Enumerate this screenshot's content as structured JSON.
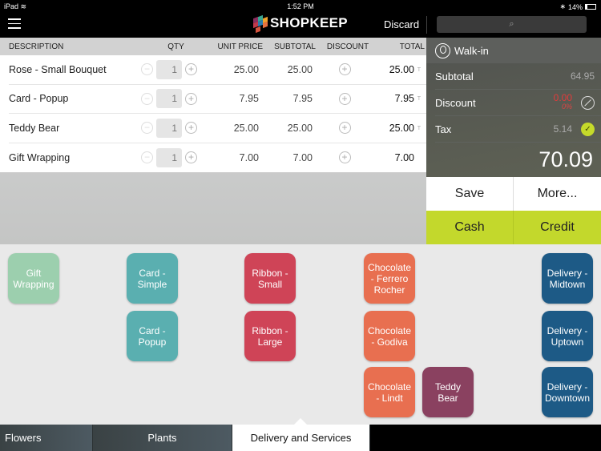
{
  "status_bar": {
    "device": "iPad",
    "time": "1:52 PM",
    "battery": "14%"
  },
  "header": {
    "brand": "SHOPKEEP",
    "discard_label": "Discard",
    "search_icon": "search-icon"
  },
  "cart": {
    "columns": {
      "description": "DESCRIPTION",
      "qty": "QTY",
      "unit_price": "UNIT PRICE",
      "subtotal": "SUBTOTAL",
      "discount": "DISCOUNT",
      "total": "TOTAL"
    },
    "rows": [
      {
        "description": "Rose - Small Bouquet",
        "qty": "1",
        "unit_price": "25.00",
        "subtotal": "25.00",
        "total": "25.00",
        "taxed": "T"
      },
      {
        "description": "Card - Popup",
        "qty": "1",
        "unit_price": "7.95",
        "subtotal": "7.95",
        "total": "7.95",
        "taxed": "T"
      },
      {
        "description": "Teddy Bear",
        "qty": "1",
        "unit_price": "25.00",
        "subtotal": "25.00",
        "total": "25.00",
        "taxed": "T"
      },
      {
        "description": "Gift Wrapping",
        "qty": "1",
        "unit_price": "7.00",
        "subtotal": "7.00",
        "total": "7.00",
        "taxed": ""
      }
    ]
  },
  "summary": {
    "customer": "Walk-in",
    "subtotal_label": "Subtotal",
    "subtotal": "64.95",
    "discount_label": "Discount",
    "discount": "0.00",
    "discount_pct": "0%",
    "tax_label": "Tax",
    "tax": "5.14",
    "grand_total": "70.09"
  },
  "actions": {
    "save": "Save",
    "more": "More...",
    "cash": "Cash",
    "credit": "Credit"
  },
  "tiles": [
    {
      "label": "Gift Wrapping",
      "color": "#9ccfae"
    },
    {
      "label": "Card - Simple",
      "color": "#5aafb0"
    },
    {
      "label": "Card - Popup",
      "color": "#5aafb0"
    },
    {
      "label": "Ribbon - Small",
      "color": "#cf4457"
    },
    {
      "label": "Ribbon - Large",
      "color": "#cf4457"
    },
    {
      "label": "Chocolate - Ferrero Rocher",
      "color": "#e86f50"
    },
    {
      "label": "Chocolate - Godiva",
      "color": "#e86f50"
    },
    {
      "label": "Chocolate - Lindt",
      "color": "#e86f50"
    },
    {
      "label": "Teddy Bear",
      "color": "#8a4160"
    },
    {
      "label": "Delivery - Midtown",
      "color": "#1d5a86"
    },
    {
      "label": "Delivery - Uptown",
      "color": "#1d5a86"
    },
    {
      "label": "Delivery - Downtown",
      "color": "#1d5a86"
    }
  ],
  "tabs": [
    {
      "label": "Flowers"
    },
    {
      "label": "Plants"
    },
    {
      "label": "Delivery and Services",
      "active": true
    }
  ],
  "colors": {
    "accent_green": "#c3d82c",
    "discount_red": "#e23b3b"
  }
}
